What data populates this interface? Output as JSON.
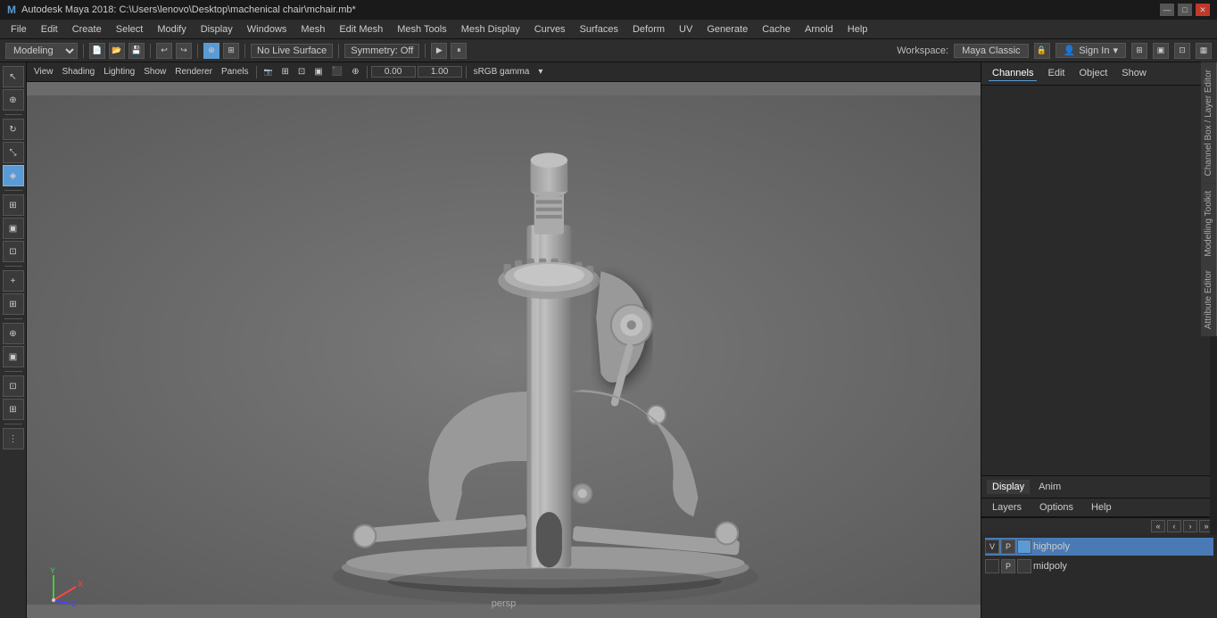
{
  "titlebar": {
    "title": "Autodesk Maya 2018: C:\\Users\\lenovo\\Desktop\\machenical chair\\mchair.mb*",
    "min_label": "—",
    "max_label": "□",
    "close_label": "✕"
  },
  "menubar": {
    "items": [
      "File",
      "Edit",
      "Create",
      "Select",
      "Modify",
      "Display",
      "Windows",
      "Mesh",
      "Edit Mesh",
      "Mesh Tools",
      "Mesh Display",
      "Curves",
      "Surfaces",
      "Deform",
      "UV",
      "Generate",
      "Cache",
      "Arnold",
      "Help"
    ]
  },
  "workspacebar": {
    "mode": "Modeling",
    "symmetry": "Symmetry: Off",
    "live_surface": "No Live Surface",
    "workspace_label": "Workspace:",
    "workspace_name": "Maya Classic",
    "sign_in": "Sign In"
  },
  "viewport_toolbar": {
    "view": "View",
    "shading": "Shading",
    "lighting": "Lighting",
    "show": "Show",
    "renderer": "Renderer",
    "panels": "Panels",
    "value1": "0.00",
    "value2": "1.00",
    "colorspace": "sRGB gamma"
  },
  "viewport": {
    "label": "persp"
  },
  "right_panel": {
    "header_tabs": [
      "Channels",
      "Edit",
      "Object",
      "Show"
    ],
    "panel_labels": [
      "Channel Box / Layer Editor",
      "Modelling Toolkit",
      "Attribute Editor"
    ]
  },
  "bottom_panel": {
    "tabs": [
      {
        "label": "Display",
        "active": true
      },
      {
        "label": "Anim",
        "active": false
      }
    ],
    "sub_tabs": [
      {
        "label": "Layers",
        "active": false
      },
      {
        "label": "Options",
        "active": false
      },
      {
        "label": "Help",
        "active": false
      }
    ],
    "layers": [
      {
        "vis": "V",
        "p": "P",
        "color": "#5b9bd5",
        "name": "highpoly",
        "selected": true
      },
      {
        "vis": "",
        "p": "P",
        "color": "#3a3a3a",
        "name": "midpoly",
        "selected": false
      }
    ]
  },
  "left_toolbar": {
    "tools": [
      {
        "icon": "↖",
        "name": "select-tool",
        "active": false
      },
      {
        "icon": "⊕",
        "name": "move-tool",
        "active": false
      },
      {
        "icon": "↻",
        "name": "rotate-tool",
        "active": false
      },
      {
        "icon": "⤡",
        "name": "scale-tool",
        "active": false
      },
      {
        "icon": "◈",
        "name": "universal-tool",
        "active": true
      },
      {
        "icon": "⊞",
        "name": "soft-select-tool",
        "active": false
      },
      {
        "icon": "▣",
        "name": "lasso-tool",
        "active": false
      },
      {
        "icon": "⊡",
        "name": "paint-tool",
        "active": false
      },
      {
        "icon": "+",
        "name": "add-tool",
        "active": false
      },
      {
        "icon": "⊞",
        "name": "snap-tool",
        "active": false
      },
      {
        "icon": "⋮",
        "name": "more-tools",
        "active": false
      }
    ]
  }
}
